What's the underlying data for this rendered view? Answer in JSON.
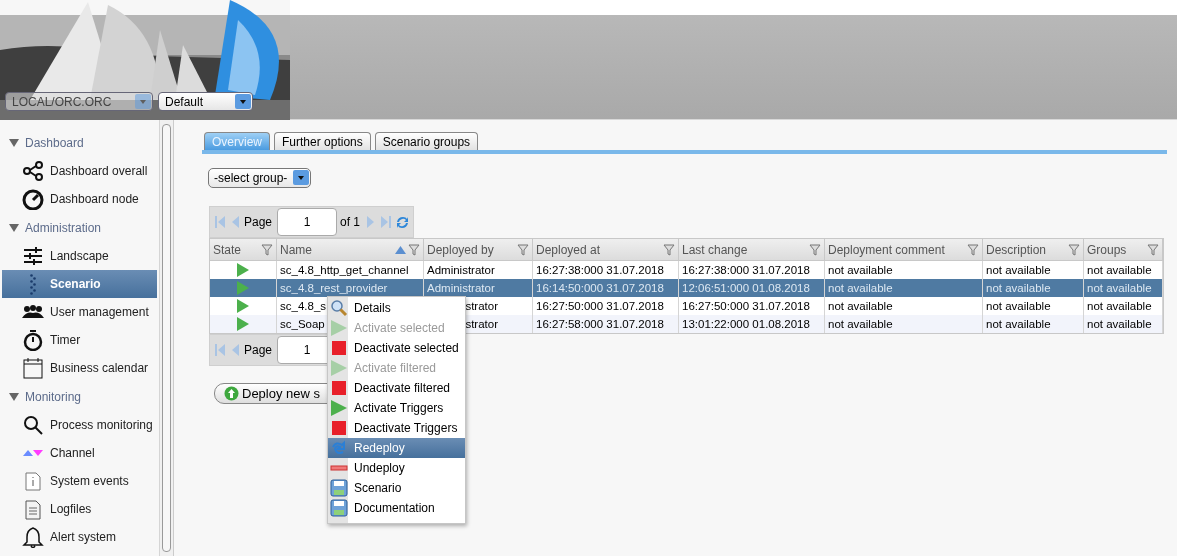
{
  "header": {
    "server_select": "LOCAL/ORC.ORC",
    "profile_select": "Default"
  },
  "sidebar": {
    "sections": [
      {
        "title": "Dashboard",
        "expanded": true,
        "items": [
          {
            "label": "Dashboard overall",
            "selected": false
          },
          {
            "label": "Dashboard node",
            "selected": false
          }
        ]
      },
      {
        "title": "Administration",
        "expanded": true,
        "items": [
          {
            "label": "Landscape",
            "selected": false
          },
          {
            "label": "Scenario",
            "selected": true
          },
          {
            "label": "User management",
            "selected": false
          },
          {
            "label": "Timer",
            "selected": false
          },
          {
            "label": "Business calendar",
            "selected": false
          }
        ]
      },
      {
        "title": "Monitoring",
        "expanded": true,
        "items": [
          {
            "label": "Process monitoring",
            "selected": false
          },
          {
            "label": "Channel",
            "selected": false
          },
          {
            "label": "System events",
            "selected": false
          },
          {
            "label": "Logfiles",
            "selected": false
          },
          {
            "label": "Alert system",
            "selected": false
          }
        ]
      }
    ]
  },
  "tabs": [
    {
      "label": "Overview",
      "selected": true
    },
    {
      "label": "Further options",
      "selected": false
    },
    {
      "label": "Scenario groups",
      "selected": false
    }
  ],
  "group_select": "-select group-",
  "pager": {
    "page_label": "Page",
    "page": "1",
    "of": "of 1"
  },
  "table": {
    "columns": [
      {
        "label": "State",
        "sorted": false
      },
      {
        "label": "Name",
        "sorted": true
      },
      {
        "label": "Deployed by",
        "sorted": false
      },
      {
        "label": "Deployed at",
        "sorted": false
      },
      {
        "label": "Last change",
        "sorted": false
      },
      {
        "label": "Deployment comment",
        "sorted": false
      },
      {
        "label": "Description",
        "sorted": false
      },
      {
        "label": "Groups",
        "sorted": false
      }
    ],
    "rows": [
      {
        "active": true,
        "selected": false,
        "covered": false,
        "cells": [
          "",
          "sc_4.8_http_get_channel",
          "Administrator",
          "16:27:38:000 31.07.2018",
          "16:27:38:000 31.07.2018",
          "not available",
          "not available",
          "not available"
        ]
      },
      {
        "active": true,
        "selected": true,
        "covered": false,
        "cells": [
          "",
          "sc_4.8_rest_provider",
          "Administrator",
          "16:14:50:000 31.07.2018",
          "12:06:51:000 01.08.2018",
          "not available",
          "not available",
          "not available"
        ]
      },
      {
        "active": true,
        "selected": false,
        "covered": true,
        "cells": [
          "",
          "sc_4.8_s",
          "strator",
          "16:27:50:000 31.07.2018",
          "16:27:50:000 31.07.2018",
          "not available",
          "not available",
          "not available"
        ]
      },
      {
        "active": true,
        "selected": false,
        "covered": true,
        "cells": [
          "",
          "sc_Soap",
          "strator",
          "16:27:58:000 31.07.2018",
          "13:01:22:000 01.08.2018",
          "not available",
          "not available",
          "not available"
        ]
      }
    ]
  },
  "pager_bottom": {
    "page_label": "Page",
    "page": "1"
  },
  "deploy_button": "Deploy new s",
  "context_menu": [
    {
      "label": "Details",
      "kind": "details",
      "disabled": false,
      "selected": false
    },
    {
      "label": "Activate selected",
      "kind": "activate",
      "disabled": true,
      "selected": false
    },
    {
      "label": "Deactivate selected",
      "kind": "deactivate",
      "disabled": false,
      "selected": false
    },
    {
      "label": "Activate filtered",
      "kind": "activate",
      "disabled": true,
      "selected": false
    },
    {
      "label": "Deactivate filtered",
      "kind": "deactivate",
      "disabled": false,
      "selected": false
    },
    {
      "label": "Activate Triggers",
      "kind": "activate",
      "disabled": false,
      "selected": false
    },
    {
      "label": "Deactivate Triggers",
      "kind": "deactivate",
      "disabled": false,
      "selected": false
    },
    {
      "label": "Redeploy",
      "kind": "redeploy",
      "disabled": false,
      "selected": true
    },
    {
      "label": "Undeploy",
      "kind": "undeploy",
      "disabled": false,
      "selected": false
    },
    {
      "label": "Scenario",
      "kind": "save",
      "disabled": false,
      "selected": false
    },
    {
      "label": "Documentation",
      "kind": "save",
      "disabled": false,
      "selected": false
    }
  ]
}
